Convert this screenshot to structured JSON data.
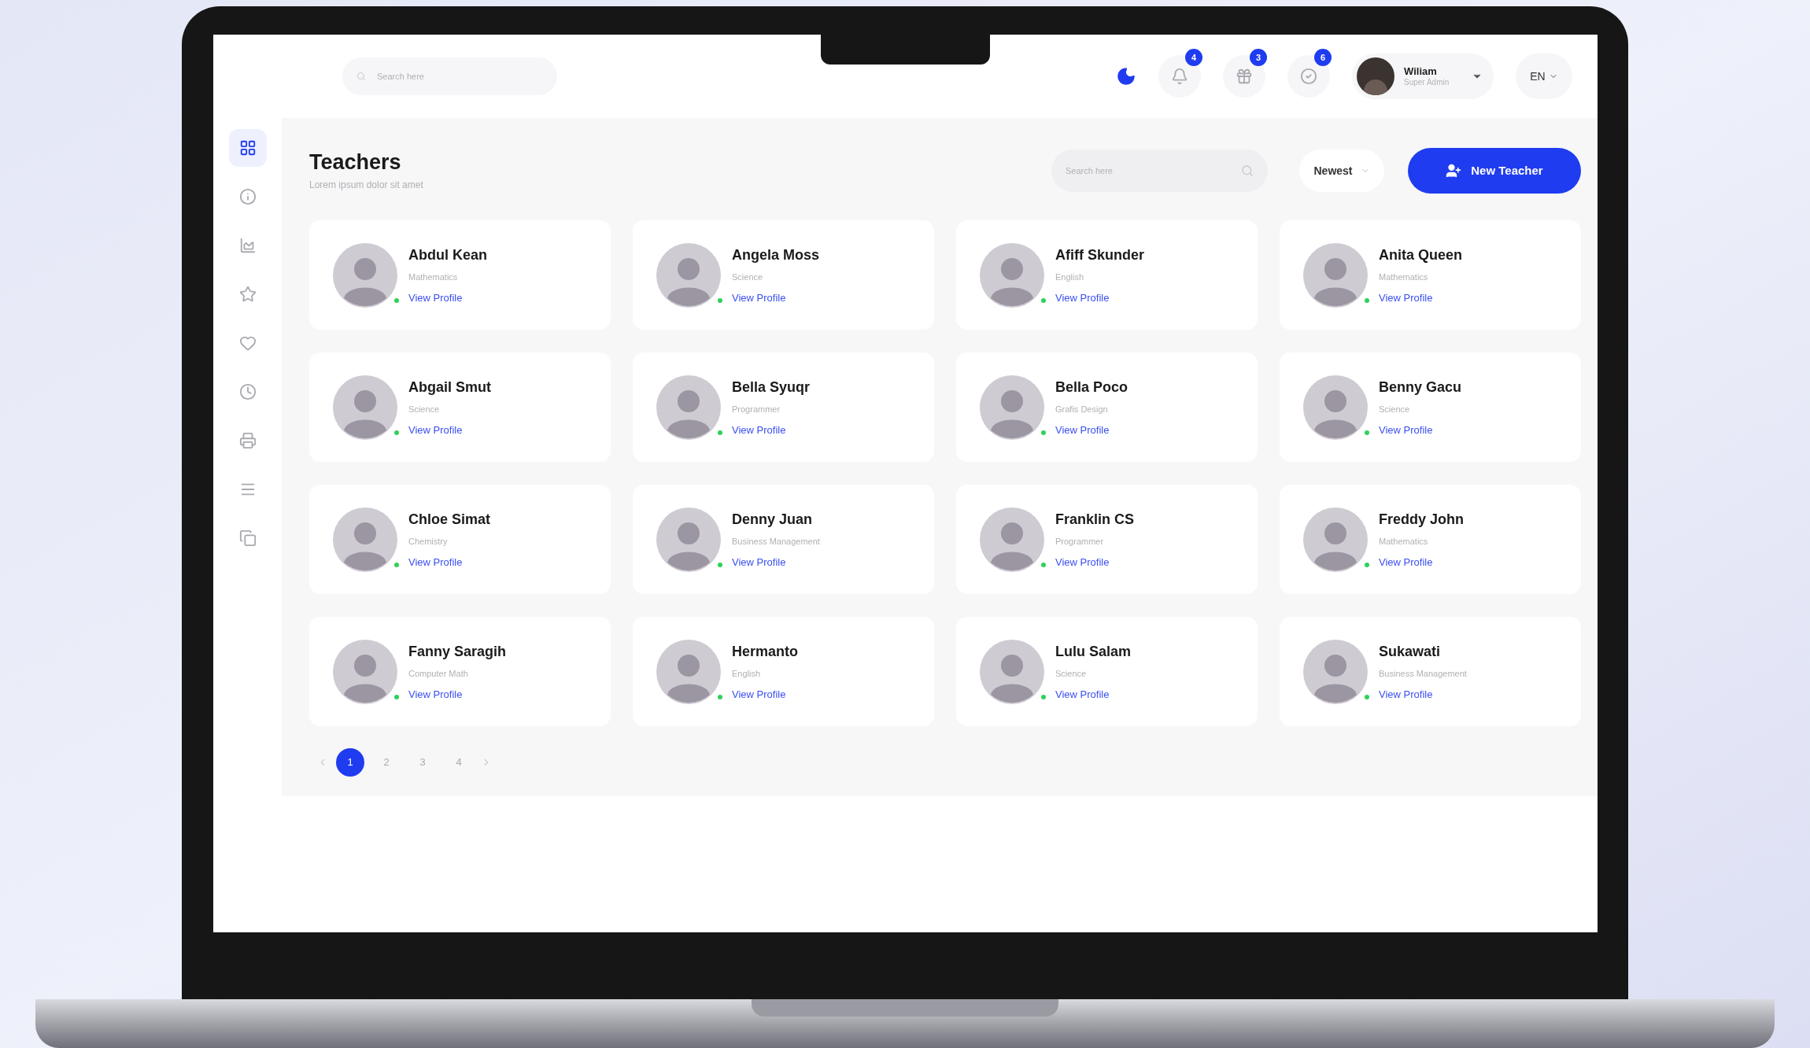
{
  "topbar": {
    "search": {
      "placeholder": "Search here"
    },
    "notifications": [
      {
        "count": "4"
      },
      {
        "count": "3"
      },
      {
        "count": "6"
      }
    ],
    "user": {
      "name": "Wiliam",
      "role": "Super Admin"
    },
    "language": "EN"
  },
  "sidebar": {
    "items": [
      {
        "selected": true
      },
      {
        "selected": false
      },
      {
        "selected": false
      },
      {
        "selected": false
      },
      {
        "selected": false
      },
      {
        "selected": false
      },
      {
        "selected": false
      },
      {
        "selected": false
      },
      {
        "selected": false
      }
    ]
  },
  "page": {
    "title": "Teachers",
    "subtitle": "Lorem ipsum dolor sit amet",
    "search": {
      "placeholder": "Search here"
    },
    "sort": "Newest",
    "new_button": "New Teacher"
  },
  "teachers": [
    {
      "name": "Abdul Kean",
      "subject": "Mathematics",
      "link": "View Profile",
      "online": true
    },
    {
      "name": "Angela Moss",
      "subject": "Science",
      "link": "View Profile",
      "online": true
    },
    {
      "name": "Afiff Skunder",
      "subject": "English",
      "link": "View Profile",
      "online": true
    },
    {
      "name": "Anita Queen",
      "subject": "Mathematics",
      "link": "View Profile",
      "online": true
    },
    {
      "name": "Abgail Smut",
      "subject": "Science",
      "link": "View Profile",
      "online": true
    },
    {
      "name": "Bella Syuqr",
      "subject": "Programmer",
      "link": "View Profile",
      "online": true
    },
    {
      "name": "Bella Poco",
      "subject": "Grafis Design",
      "link": "View Profile",
      "online": true
    },
    {
      "name": "Benny Gacu",
      "subject": "Science",
      "link": "View Profile",
      "online": true
    },
    {
      "name": "Chloe Simat",
      "subject": "Chemistry",
      "link": "View Profile",
      "online": true
    },
    {
      "name": "Denny Juan",
      "subject": "Business Management",
      "link": "View Profile",
      "online": true
    },
    {
      "name": "Franklin CS",
      "subject": "Programmer",
      "link": "View Profile",
      "online": true
    },
    {
      "name": "Freddy John",
      "subject": "Mathematics",
      "link": "View Profile",
      "online": true
    },
    {
      "name": "Fanny Saragih",
      "subject": "Computer Math",
      "link": "View Profile",
      "online": true
    },
    {
      "name": "Hermanto",
      "subject": "English",
      "link": "View Profile",
      "online": true
    },
    {
      "name": "Lulu Salam",
      "subject": "Science",
      "link": "View Profile",
      "online": true
    },
    {
      "name": "Sukawati",
      "subject": "Business Management",
      "link": "View Profile",
      "online": true
    }
  ],
  "pagination": {
    "pages": [
      {
        "label": "1",
        "selected": true
      },
      {
        "label": "2",
        "selected": false
      },
      {
        "label": "3",
        "selected": false
      },
      {
        "label": "4",
        "selected": false
      }
    ]
  }
}
